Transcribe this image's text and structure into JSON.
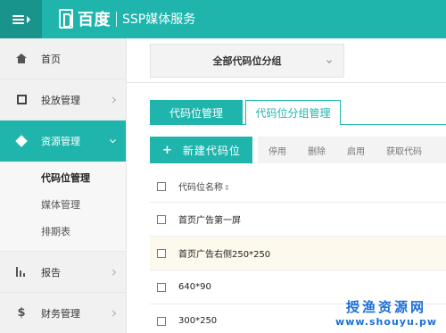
{
  "header": {
    "brand_name": "百度",
    "service_name": "SSP媒体服务"
  },
  "sidebar": {
    "items": [
      {
        "label": "首页"
      },
      {
        "label": "投放管理"
      },
      {
        "label": "资源管理"
      },
      {
        "label": "报告"
      },
      {
        "label": "财务管理"
      }
    ],
    "submenu": [
      {
        "label": "代码位管理"
      },
      {
        "label": "媒体管理"
      },
      {
        "label": "排期表"
      }
    ]
  },
  "group_filter": {
    "selected": "全部代码位分组"
  },
  "tabs": [
    {
      "label": "代码位管理"
    },
    {
      "label": "代码位分组管理"
    }
  ],
  "toolbar": {
    "new_label": "新建代码位",
    "actions": [
      "停用",
      "删除",
      "启用",
      "获取代码"
    ]
  },
  "table": {
    "header": "代码位名称",
    "rows": [
      {
        "name": "首页广告第一屏"
      },
      {
        "name": "首页广告右侧250*250"
      },
      {
        "name": "640*90"
      },
      {
        "name": "300*250"
      }
    ]
  },
  "watermark": {
    "line1": "授渔资源网",
    "line2": "www.shouyu.pw"
  },
  "colors": {
    "accent": "#1fb5ad",
    "accent_dark": "#19948d",
    "highlight_row": "#fdf9ec"
  }
}
